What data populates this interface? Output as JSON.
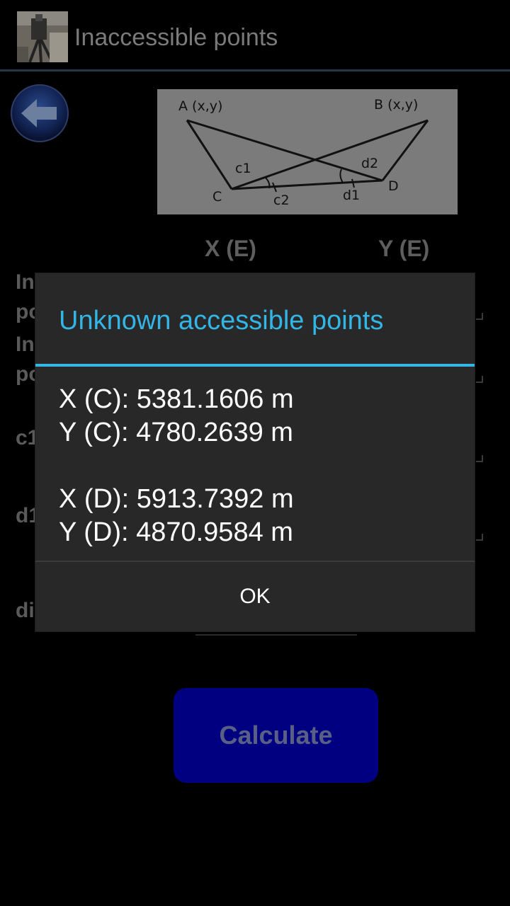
{
  "app": {
    "title": "Inaccessible points",
    "icon": "total-station-photo-icon"
  },
  "main": {
    "back_icon": "back-arrow-icon",
    "diagram_labels": {
      "a": "A (x,y)",
      "b": "B (x,y)",
      "c": "C",
      "d": "D",
      "c1": "c1",
      "c2": "c2",
      "d1": "d1",
      "d2": "d2"
    },
    "col_x": "X (E)",
    "col_y": "Y (E)",
    "rows": [
      {
        "label_line1": "In",
        "label_line2": "po"
      },
      {
        "label_line1": "In",
        "label_line2": "po"
      },
      {
        "label": "c1"
      },
      {
        "label": "d1"
      },
      {
        "label": "di"
      }
    ],
    "calculate_label": "Calculate"
  },
  "dialog": {
    "title": "Unknown accessible points",
    "lines": [
      "X (C): 5381.1606 m",
      "Y (C): 4780.2639 m",
      "X (D): 5913.7392 m",
      "Y (D): 4870.9584 m"
    ],
    "ok_label": "OK"
  },
  "colors": {
    "accent": "#33b5e5",
    "dialog_bg": "#282828",
    "calculate_bg": "#000080"
  }
}
